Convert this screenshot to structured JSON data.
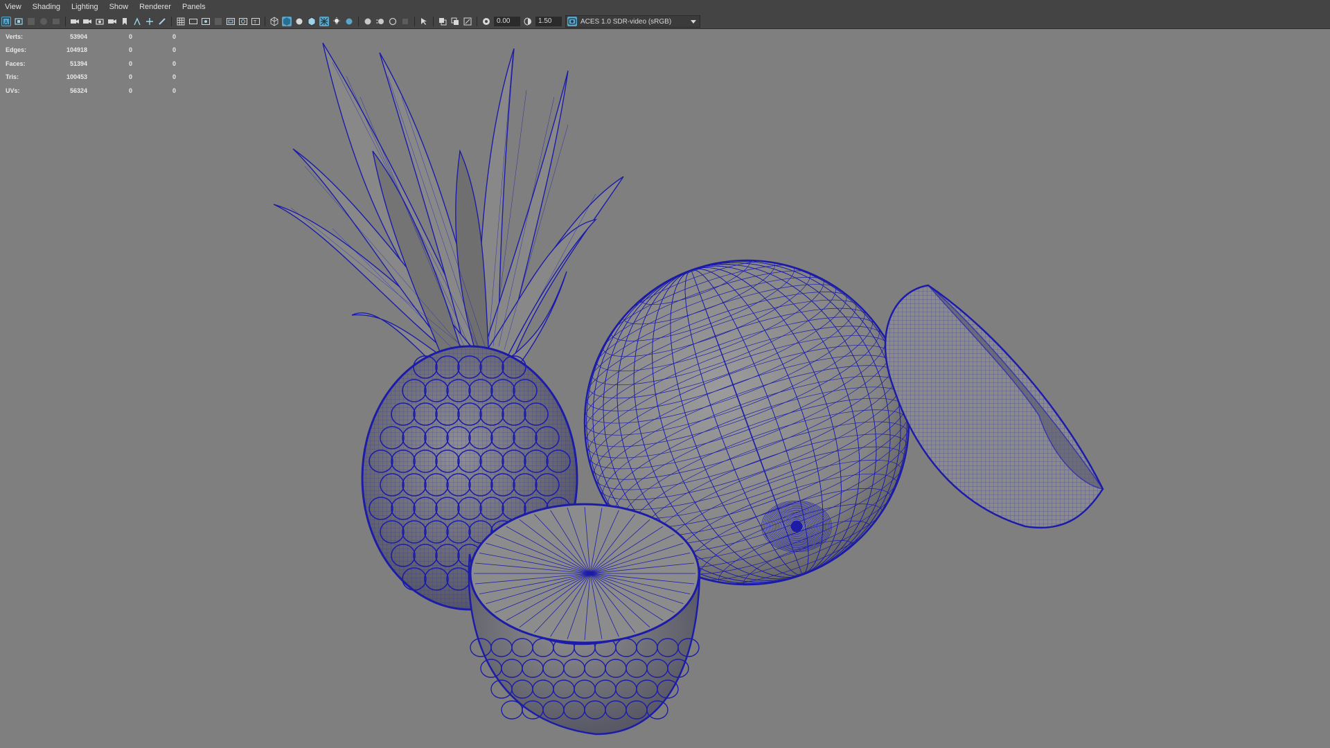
{
  "menu": {
    "items": [
      {
        "label": "View"
      },
      {
        "label": "Shading"
      },
      {
        "label": "Lighting"
      },
      {
        "label": "Show"
      },
      {
        "label": "Renderer"
      },
      {
        "label": "Panels"
      }
    ]
  },
  "toolbar": {
    "exposure_value": "0.00",
    "gamma_value": "1.50",
    "color_space_label": "ACES 1.0 SDR-video (sRGB)"
  },
  "hud": {
    "rows": [
      {
        "label": "Verts:",
        "values": [
          "53904",
          "0",
          "0"
        ]
      },
      {
        "label": "Edges:",
        "values": [
          "104918",
          "0",
          "0"
        ]
      },
      {
        "label": "Faces:",
        "values": [
          "51394",
          "0",
          "0"
        ]
      },
      {
        "label": "Tris:",
        "values": [
          "100453",
          "0",
          "0"
        ]
      },
      {
        "label": "UVs:",
        "values": [
          "56324",
          "0",
          "0"
        ]
      }
    ]
  },
  "colors": {
    "viewport_bg": "#7f7f7f",
    "wireframe": "#1c1ca8",
    "mesh_fill": "#8a8a8a",
    "ui_panel": "#444444",
    "accent": "#5aa6c8"
  },
  "viewport": {
    "objects": [
      "pineapple",
      "pineapple-half",
      "orange",
      "orange-half"
    ]
  }
}
